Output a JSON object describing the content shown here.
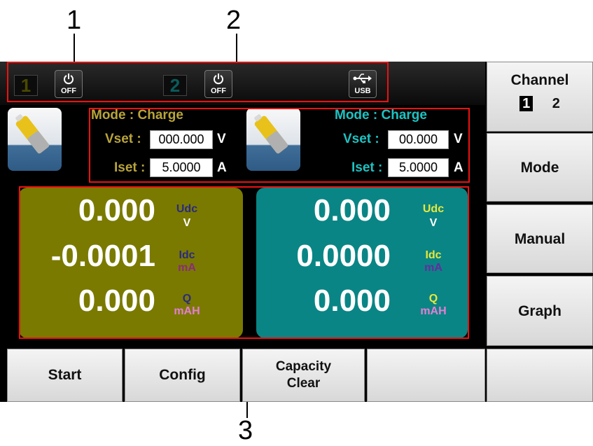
{
  "callouts": [
    "1",
    "2",
    "3"
  ],
  "status_bar": {
    "ch1_number": "1",
    "ch1_power_label": "OFF",
    "ch2_number": "2",
    "ch2_power_label": "OFF",
    "usb_label": "USB"
  },
  "channel1": {
    "mode_label": "Mode : Charge",
    "vset_label": "Vset :",
    "vset_value": "000.000",
    "vset_unit": "V",
    "iset_label": "Iset :",
    "iset_value": "5.0000",
    "iset_unit": "A",
    "voltage": "0.000",
    "voltage_label": "Udc",
    "voltage_unit": "V",
    "current": "-0.0001",
    "current_label": "Idc",
    "current_unit": "mA",
    "capacity": "0.000",
    "capacity_label": "Q",
    "capacity_unit": "mAH"
  },
  "channel2": {
    "mode_label": "Mode : Charge",
    "vset_label": "Vset :",
    "vset_value": "00.000",
    "vset_unit": "V",
    "iset_label": "Iset :",
    "iset_value": "5.0000",
    "iset_unit": "A",
    "voltage": "0.000",
    "voltage_label": "Udc",
    "voltage_unit": "V",
    "current": "0.0000",
    "current_label": "Idc",
    "current_unit": "mA",
    "capacity": "0.000",
    "capacity_label": "Q",
    "capacity_unit": "mAH"
  },
  "softkeys_right": {
    "channel_label": "Channel",
    "channel_opt1": "1",
    "channel_opt2": "2",
    "mode": "Mode",
    "manual": "Manual",
    "graph": "Graph"
  },
  "softkeys_bottom": {
    "start": "Start",
    "config": "Config",
    "capacity_line1": "Capacity",
    "capacity_line2": "Clear",
    "empty1": "",
    "empty2": ""
  },
  "colors": {
    "ch1_panel": "#7a7a00",
    "ch2_panel": "#0a8585",
    "ch1_text": "#b8a43a",
    "ch2_text": "#1ec2c2",
    "highlight_box": "#e11111"
  }
}
